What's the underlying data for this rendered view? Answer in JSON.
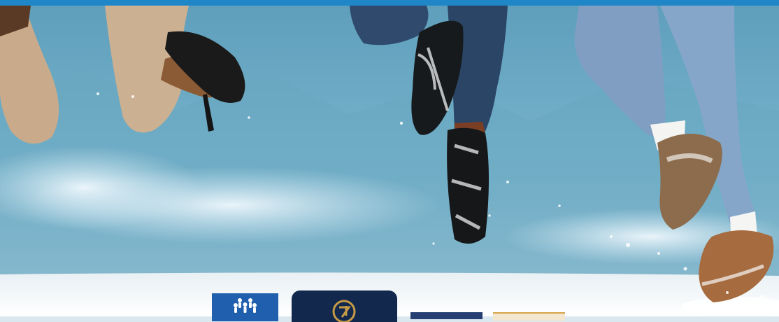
{
  "image": {
    "description_colors": {
      "top_bar": "#1f86c8",
      "sky_blue": "#68a9c5",
      "snow": "#eef3f6",
      "partner_blue": "#1f5fae",
      "partner_navy": "#13284d",
      "partner_gold": "#c59a46"
    }
  },
  "partner_logos": [
    {
      "name": "partner-logo-blue-family",
      "text": ""
    },
    {
      "name": "partner-logo-navy-circle",
      "text": ""
    },
    {
      "name": "partner-logo-dark-blue",
      "text": ""
    },
    {
      "name": "partner-logo-gold",
      "text": ""
    }
  ]
}
